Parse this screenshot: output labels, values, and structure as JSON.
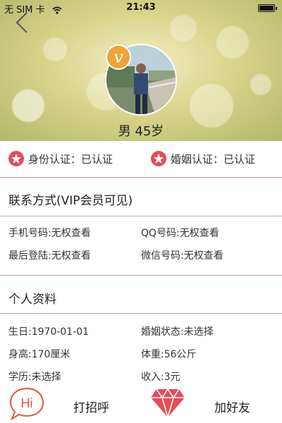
{
  "status_bar": {
    "carrier": "无 SIM 卡",
    "time": "21:43"
  },
  "profile": {
    "vip_badge": "v",
    "gender_age": "男 45岁"
  },
  "verification": {
    "identity": "身份认证：已认证",
    "marriage": "婚姻认证：已认证"
  },
  "contact": {
    "title": "联系方式(VIP会员可见)",
    "phone": "手机号码:无权查看",
    "qq": "QQ号码:无权查看",
    "last_login": "最后登陆:无权查看",
    "wechat": "微信号码:无权查看"
  },
  "personal": {
    "title": "个人资料",
    "birthday": "生日:1970-01-01",
    "marital": "婚姻状态:未选择",
    "height": "身高:170厘米",
    "weight": "体重:56公斤",
    "education": "学历:未选择",
    "income": "收入:3元"
  },
  "actions": {
    "greet_icon_text": "Hi",
    "greet": "打招呼",
    "add_friend": "加好友"
  },
  "colors": {
    "accent_red": "#e24e57",
    "vip_orange": "#f0a33b",
    "divider": "#c9a3a3"
  }
}
